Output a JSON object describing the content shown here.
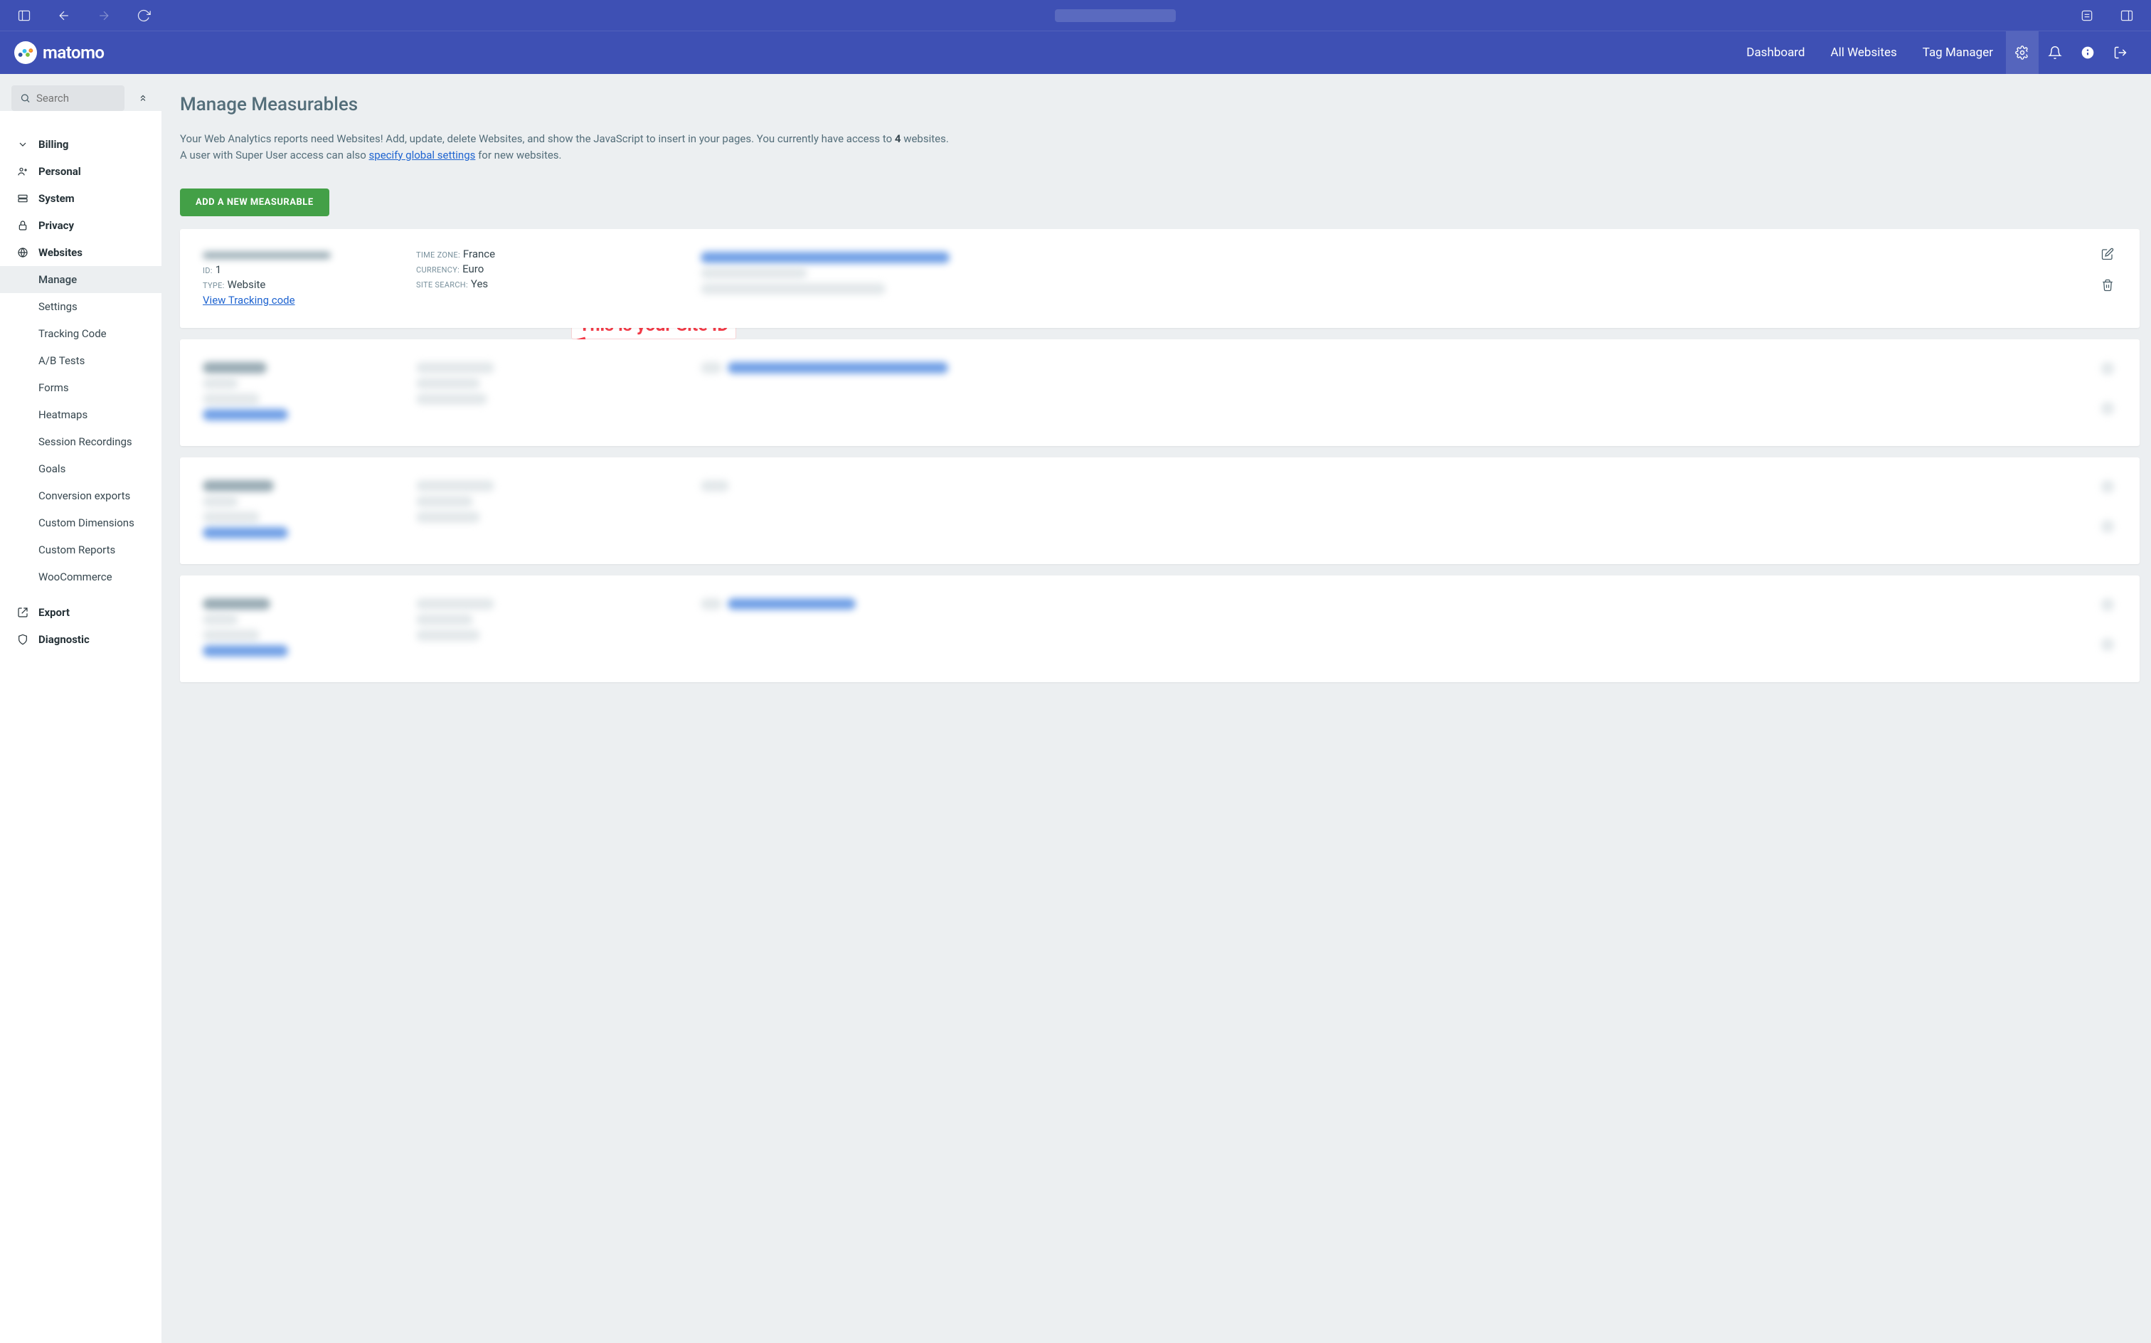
{
  "chrome": {},
  "header": {
    "brand": "matomo",
    "nav": {
      "dashboard": "Dashboard",
      "all_websites": "All Websites",
      "tag_manager": "Tag Manager"
    }
  },
  "sidebar": {
    "search_placeholder": "Search",
    "groups": [
      {
        "icon": "chevron",
        "label": "Billing"
      },
      {
        "icon": "person",
        "label": "Personal"
      },
      {
        "icon": "server",
        "label": "System"
      },
      {
        "icon": "lock",
        "label": "Privacy"
      },
      {
        "icon": "globe",
        "label": "Websites"
      }
    ],
    "websites_sub": [
      "Manage",
      "Settings",
      "Tracking Code",
      "A/B Tests",
      "Forms",
      "Heatmaps",
      "Session Recordings",
      "Goals",
      "Conversion exports",
      "Custom Dimensions",
      "Custom Reports",
      "WooCommerce"
    ],
    "groups_after": [
      {
        "icon": "export",
        "label": "Export"
      },
      {
        "icon": "shield",
        "label": "Diagnostic"
      }
    ]
  },
  "page": {
    "title": "Manage Measurables",
    "intro": {
      "line1_a": "Your Web Analytics reports need Websites! Add, update, delete Websites, and show the JavaScript to insert in your pages. You currently have access to ",
      "line1_count": "4",
      "line1_b": " websites.",
      "line2_a": "A user with Super User access can also ",
      "line2_link": "specify global settings",
      "line2_b": " for new websites."
    },
    "add_button": "ADD A NEW MEASURABLE",
    "annotation": "This is your Site ID"
  },
  "card": {
    "labels": {
      "id": "ID:",
      "type": "TYPE:",
      "time_zone": "TIME ZONE:",
      "currency": "CURRENCY:",
      "site_search": "SITE SEARCH:"
    },
    "values": {
      "id": "1",
      "type": "Website",
      "time_zone": "France",
      "currency": "Euro",
      "site_search": "Yes"
    },
    "tracking_link": "View Tracking code"
  }
}
